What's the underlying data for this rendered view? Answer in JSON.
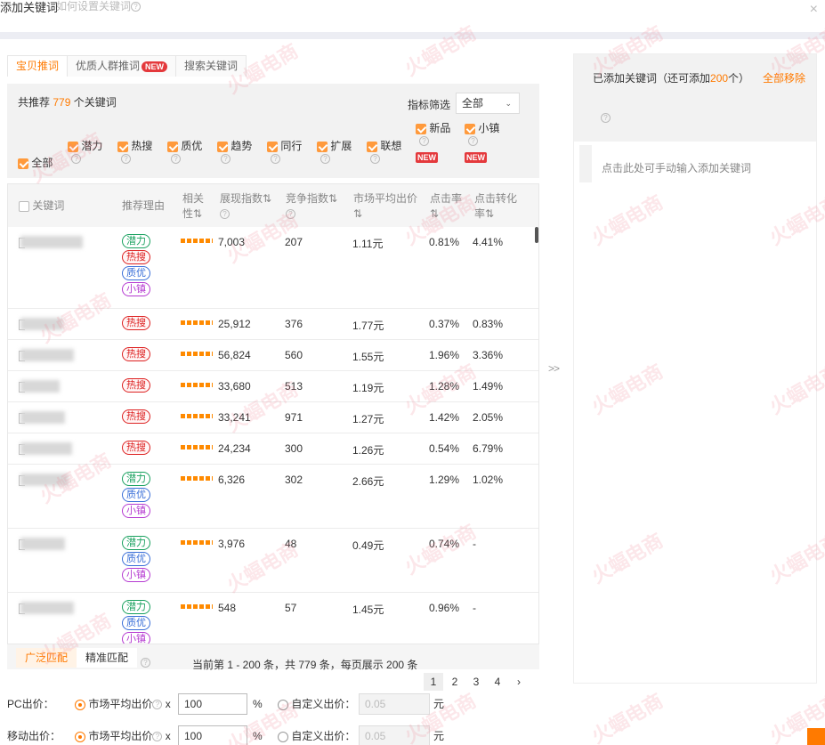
{
  "dialog": {
    "title": "添加关键词",
    "help_link": "如何设置关键词",
    "close_symbol": "×"
  },
  "tabs": [
    {
      "label": "宝贝推词",
      "active": true
    },
    {
      "label": "优质人群推词",
      "badge": "NEW",
      "active": false
    },
    {
      "label": "搜索关键词",
      "active": false
    }
  ],
  "filter": {
    "rec_prefix": "共推荐",
    "rec_count": "779",
    "rec_suffix": "个关键词",
    "metric_label": "指标筛选",
    "metric_value": "全部",
    "all_label": "全部",
    "items": [
      "潜力",
      "热搜",
      "质优",
      "趋势",
      "同行",
      "扩展",
      "联想",
      "新品",
      "小镇"
    ],
    "new_badge": "NEW"
  },
  "table": {
    "headers": {
      "keyword": "关键词",
      "reason": "推荐理由",
      "relevance": [
        "相关",
        "性⇅"
      ],
      "impression": "展现指数⇅",
      "competition": "竞争指数⇅",
      "avg_bid": [
        "市场平均出价",
        "⇅"
      ],
      "ctr": [
        "点击率",
        "⇅"
      ],
      "cvr": [
        "点击转化",
        "率⇅"
      ]
    },
    "rows": [
      {
        "tags": [
          "潜力",
          "热搜",
          "质优",
          "小镇"
        ],
        "impression": "7,003",
        "competition": "207",
        "bid": "1.11元",
        "ctr": "0.81%",
        "cvr": "4.41%"
      },
      {
        "tags": [
          "热搜"
        ],
        "impression": "25,912",
        "competition": "376",
        "bid": "1.77元",
        "ctr": "0.37%",
        "cvr": "0.83%"
      },
      {
        "tags": [
          "热搜"
        ],
        "impression": "56,824",
        "competition": "560",
        "bid": "1.55元",
        "ctr": "1.96%",
        "cvr": "3.36%"
      },
      {
        "tags": [
          "热搜"
        ],
        "impression": "33,680",
        "competition": "513",
        "bid": "1.19元",
        "ctr": "1.28%",
        "cvr": "1.49%"
      },
      {
        "tags": [
          "热搜"
        ],
        "impression": "33,241",
        "competition": "971",
        "bid": "1.27元",
        "ctr": "1.42%",
        "cvr": "2.05%"
      },
      {
        "tags": [
          "热搜"
        ],
        "impression": "24,234",
        "competition": "300",
        "bid": "1.26元",
        "ctr": "0.54%",
        "cvr": "6.79%"
      },
      {
        "tags": [
          "潜力",
          "质优",
          "小镇"
        ],
        "impression": "6,326",
        "competition": "302",
        "bid": "2.66元",
        "ctr": "1.29%",
        "cvr": "1.02%"
      },
      {
        "tags": [
          "潜力",
          "质优",
          "小镇"
        ],
        "impression": "3,976",
        "competition": "48",
        "bid": "0.49元",
        "ctr": "0.74%",
        "cvr": "-"
      },
      {
        "tags": [
          "潜力",
          "质优",
          "小镇"
        ],
        "impression": "548",
        "competition": "57",
        "bid": "1.45元",
        "ctr": "0.96%",
        "cvr": "-"
      }
    ]
  },
  "match": {
    "broad": "广泛匹配",
    "exact": "精准匹配",
    "page_info": "当前第 1 - 200 条，共 779 条，每页展示 200 条",
    "pages": [
      "1",
      "2",
      "3",
      "4"
    ],
    "next": "›"
  },
  "bids": {
    "pc_label": "PC出价：",
    "mobile_label": "移动出价：",
    "market_label": "市场平均出价",
    "x": "x",
    "pc_value": "100",
    "mobile_value": "100",
    "percent": "%",
    "custom_label": "自定义出价：",
    "custom_placeholder": "0.05",
    "yuan": "元"
  },
  "right": {
    "title_prefix": "已添加关键词（还可添加",
    "remain": "200",
    "title_suffix": "个）",
    "remove_all": "全部移除",
    "input_hint": "点击此处可手动输入添加关键词",
    "arrow": ">>"
  },
  "watermark": "火蝠电商",
  "colors": {
    "accent": "#ff7a00",
    "hot": "#dd2222",
    "potential": "#19a15f",
    "quality": "#3a6fd8",
    "town": "#b53ad1"
  }
}
